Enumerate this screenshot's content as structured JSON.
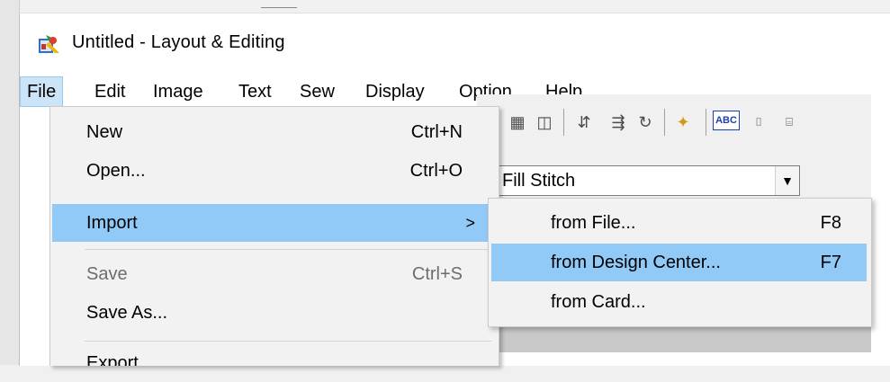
{
  "window": {
    "title": "Untitled - Layout & Editing"
  },
  "menu_bar": {
    "items": [
      "File",
      "Edit",
      "Image",
      "Text",
      "Sew",
      "Display",
      "Option",
      "Help"
    ],
    "active": "File"
  },
  "toolbar": {
    "abc_label": "ABC",
    "stitch_type": "Fill Stitch"
  },
  "file_menu": {
    "items": [
      {
        "label": "New",
        "shortcut": "Ctrl+N",
        "enabled": true
      },
      {
        "label": "Open...",
        "shortcut": "Ctrl+O",
        "enabled": true
      },
      {
        "label": "Import",
        "submenu_arrow": ">",
        "highlighted": true
      },
      {
        "label": "Save",
        "shortcut": "Ctrl+S",
        "enabled": false
      },
      {
        "label": "Save As...",
        "shortcut": "",
        "enabled": true
      },
      {
        "label": "Export",
        "shortcut": "",
        "enabled": true
      }
    ]
  },
  "import_submenu": {
    "items": [
      {
        "label": "from File...",
        "shortcut": "F8"
      },
      {
        "label": "from Design Center...",
        "shortcut": "F7",
        "highlighted": true
      },
      {
        "label": "from Card...",
        "shortcut": ""
      }
    ]
  },
  "colors": {
    "menu_highlight": "#91c9f7",
    "menubar_active": "#cce4f7",
    "disabled_text": "#6d6d6d"
  }
}
